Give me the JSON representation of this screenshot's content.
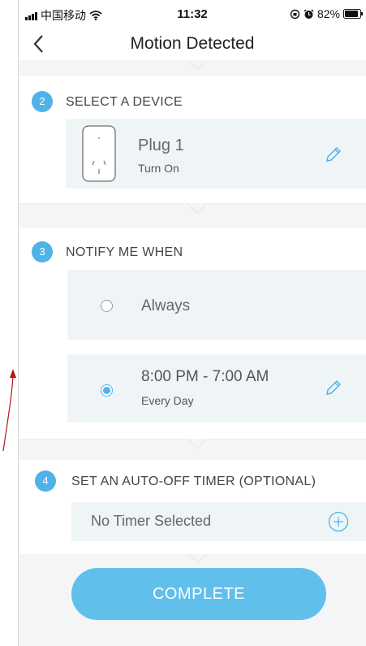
{
  "status": {
    "carrier": "中国移动",
    "time": "11:32",
    "battery": "82%"
  },
  "nav": {
    "title": "Motion Detected"
  },
  "device_section": {
    "step": "2",
    "title": "SELECT A DEVICE",
    "device_name": "Plug 1",
    "device_action": "Turn On"
  },
  "notify_section": {
    "step": "3",
    "title": "NOTIFY ME WHEN",
    "options": [
      {
        "label": "Always",
        "selected": false
      },
      {
        "label": "8:00 PM - 7:00 AM",
        "sublabel": "Every Day",
        "selected": true
      }
    ]
  },
  "timer_section": {
    "step": "4",
    "title": "SET AN AUTO-OFF TIMER (OPTIONAL)",
    "value": "No Timer Selected"
  },
  "complete_label": "COMPLETE",
  "colors": {
    "accent": "#4fb3e8",
    "button": "#61bfec",
    "card": "#eff5f7",
    "annotation": "#b5141c"
  }
}
